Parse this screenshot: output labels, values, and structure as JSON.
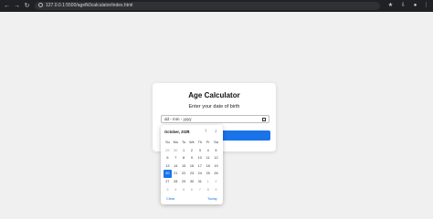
{
  "browser": {
    "url": "127.0.0.1:5500/agefk0calculator/index.html"
  },
  "card": {
    "title": "Age Calculator",
    "subtitle": "Enter your date of birth",
    "date_value": "dd - mm - yyyy",
    "button_label": "e"
  },
  "picker": {
    "month_label": "October, 2024",
    "weekdays": [
      "Su",
      "Mo",
      "Tu",
      "We",
      "Th",
      "Fr",
      "Sa"
    ],
    "days": [
      {
        "d": "29",
        "dim": true
      },
      {
        "d": "30",
        "dim": true
      },
      {
        "d": "1"
      },
      {
        "d": "2"
      },
      {
        "d": "3"
      },
      {
        "d": "4"
      },
      {
        "d": "5"
      },
      {
        "d": "6"
      },
      {
        "d": "7"
      },
      {
        "d": "8"
      },
      {
        "d": "9"
      },
      {
        "d": "10"
      },
      {
        "d": "11"
      },
      {
        "d": "12"
      },
      {
        "d": "13"
      },
      {
        "d": "14"
      },
      {
        "d": "15"
      },
      {
        "d": "16"
      },
      {
        "d": "17"
      },
      {
        "d": "18"
      },
      {
        "d": "19"
      },
      {
        "d": "20",
        "selected": true
      },
      {
        "d": "21"
      },
      {
        "d": "22"
      },
      {
        "d": "23"
      },
      {
        "d": "24"
      },
      {
        "d": "25"
      },
      {
        "d": "26"
      },
      {
        "d": "27"
      },
      {
        "d": "28"
      },
      {
        "d": "29"
      },
      {
        "d": "30"
      },
      {
        "d": "31"
      },
      {
        "d": "1",
        "dim": true
      },
      {
        "d": "2",
        "dim": true
      },
      {
        "d": "3",
        "dim": true
      },
      {
        "d": "4",
        "dim": true
      },
      {
        "d": "5",
        "dim": true
      },
      {
        "d": "6",
        "dim": true
      },
      {
        "d": "7",
        "dim": true
      },
      {
        "d": "8",
        "dim": true
      },
      {
        "d": "9",
        "dim": true
      }
    ],
    "clear_label": "Clear",
    "today_label": "Today"
  },
  "colors": {
    "accent": "#1a73e8",
    "page_bg": "#f0f0f0"
  }
}
